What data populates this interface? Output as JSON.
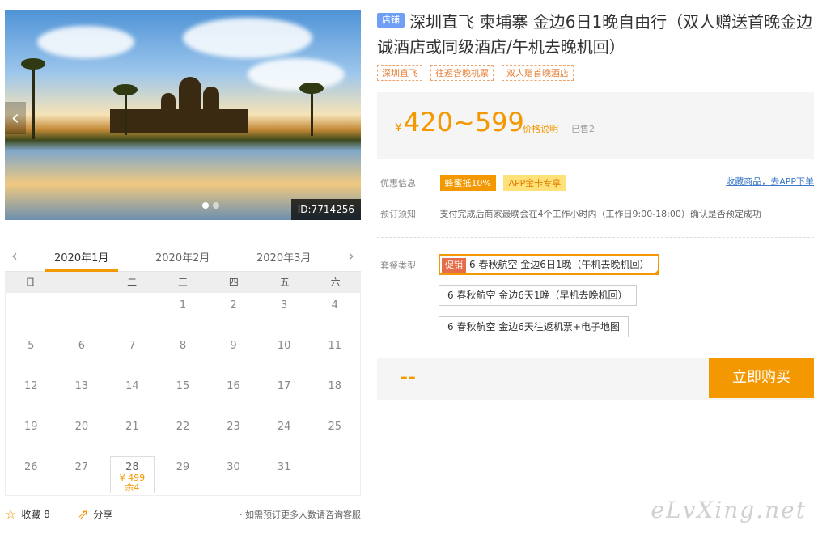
{
  "photo": {
    "id_tag": "ID:7714256",
    "prev_arrow": "‹",
    "next_arrow": "›"
  },
  "calendar": {
    "months": [
      "2020年1月",
      "2020年2月",
      "2020年3月"
    ],
    "weekdays": [
      "日",
      "一",
      "二",
      "三",
      "四",
      "五",
      "六"
    ],
    "days": [
      "",
      "",
      "",
      "1",
      "2",
      "3",
      "4",
      "5",
      "6",
      "7",
      "8",
      "9",
      "10",
      "11",
      "12",
      "13",
      "14",
      "15",
      "16",
      "17",
      "18",
      "19",
      "20",
      "21",
      "22",
      "23",
      "24",
      "25",
      "26",
      "27",
      "28",
      "29",
      "30",
      "31",
      ""
    ],
    "available": {
      "day": "28",
      "price": "¥ 499",
      "stock": "余4"
    },
    "footer": {
      "favorite_label": "收藏 8",
      "share_label": "分享",
      "tip": "· 如需预订更多人数请咨询客服"
    }
  },
  "product": {
    "shop_badge": "店铺",
    "title": "深圳直飞 柬埔寨 金边6日1晚自由行（双人赠送首晚金边诚酒店或同级酒店/午机去晚机回）",
    "tags": [
      "深圳直飞",
      "往返含晚机票",
      "双人赠首晚酒店"
    ],
    "price": {
      "currency": "¥",
      "range": "420~599",
      "explain": "价格说明",
      "sold": "已售2"
    },
    "discount": {
      "label": "优惠信息",
      "promo": "蜂蜜抵10%",
      "app": "APP金卡专享",
      "collect_link": "收藏商品，去APP下单"
    },
    "notice": {
      "label": "预订须知",
      "text": "支付完成后商家最晚会在4个工作小时内（工作日9:00-18:00）确认是否预定成功"
    },
    "packages": {
      "label": "套餐类型",
      "promo_badge": "促销",
      "items": [
        "6 春秋航空 金边6日1晚（午机去晚机回）",
        "6 春秋航空 金边6天1晚（早机去晚机回）",
        "6 春秋航空 金边6天往返机票+电子地图"
      ]
    },
    "buy": {
      "total": "--",
      "button": "立即购买"
    }
  },
  "watermark": "eLvXing.net",
  "colors": {
    "accent": "#f39800",
    "link": "#3c78c8",
    "shop_badge": "#6f9ff5"
  }
}
